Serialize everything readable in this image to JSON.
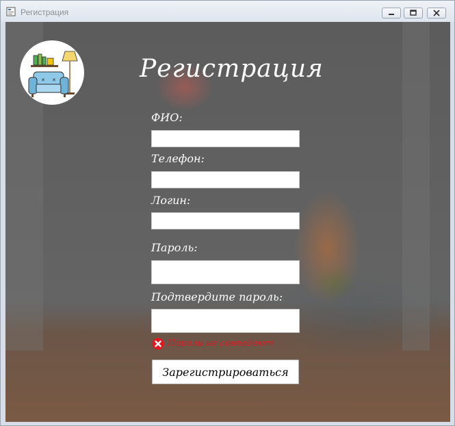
{
  "window": {
    "title": "Регистрация",
    "icon": "app-form-icon",
    "controls": [
      "minimize-icon",
      "restore-icon",
      "close-icon"
    ]
  },
  "form": {
    "heading": "Регистрация",
    "logo": "armchair-lamp-shelf-logo",
    "fields": {
      "fio": {
        "label": "ФИО:",
        "value": ""
      },
      "phone": {
        "label": "Телефон:",
        "value": ""
      },
      "login": {
        "label": "Логин:",
        "value": ""
      },
      "password": {
        "label": "Пароль:",
        "value": ""
      },
      "confirm_password": {
        "label": "Подтвердите пароль:",
        "value": ""
      }
    },
    "error": {
      "icon": "error-x-icon",
      "text": "Пароли не совпадают"
    },
    "submit_label": "Зарегистрироваться"
  },
  "colors": {
    "error": "#e8141e",
    "text_light": "#ffffff"
  }
}
